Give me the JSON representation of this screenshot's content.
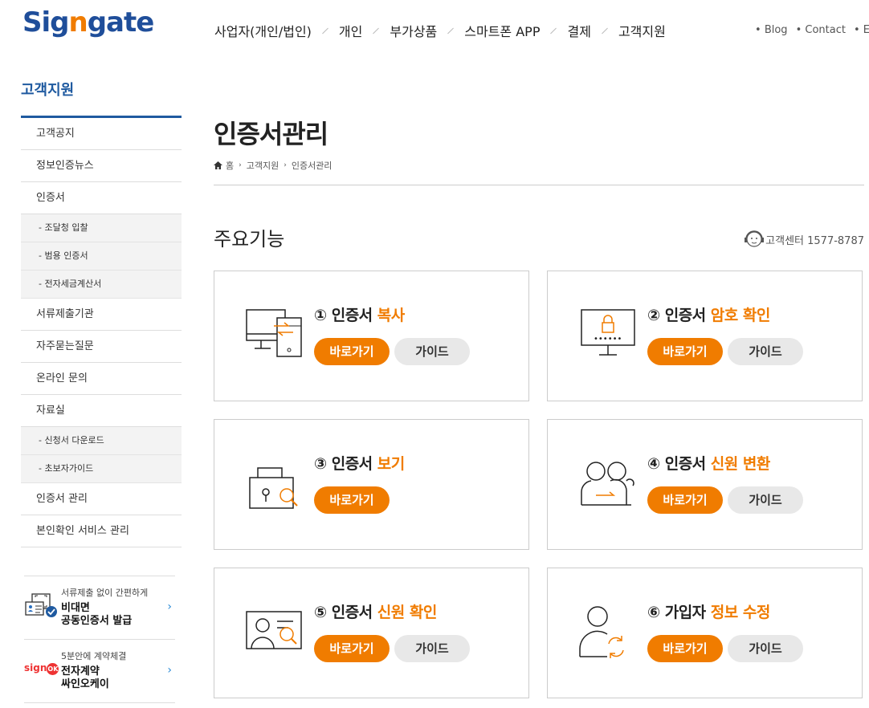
{
  "header": {
    "logo": "Signgate",
    "nav": [
      "사업자(개인/법인)",
      "개인",
      "부가상품",
      "스마트폰 APP",
      "결제",
      "고객지원"
    ],
    "util": [
      "Blog",
      "Contact",
      "Eng"
    ]
  },
  "sidebar": {
    "title": "고객지원",
    "items": [
      {
        "label": "고객공지",
        "sub": false
      },
      {
        "label": "정보인증뉴스",
        "sub": false
      },
      {
        "label": "인증서",
        "sub": false
      },
      {
        "label": "- 조달청 입찰",
        "sub": true
      },
      {
        "label": "- 범용 인증서",
        "sub": true
      },
      {
        "label": "- 전자세금계산서",
        "sub": true
      },
      {
        "label": "서류제출기관",
        "sub": false
      },
      {
        "label": "자주묻는질문",
        "sub": false
      },
      {
        "label": "온라인 문의",
        "sub": false
      },
      {
        "label": "자료실",
        "sub": false
      },
      {
        "label": "- 신청서 다운로드",
        "sub": true
      },
      {
        "label": "- 초보자가이드",
        "sub": true
      },
      {
        "label": "인증서 관리",
        "sub": false
      },
      {
        "label": "본인확인 서비스 관리",
        "sub": false
      }
    ],
    "banners": [
      {
        "small": "서류제출 없이 간편하게",
        "big": "비대면\n공동인증서 발급"
      },
      {
        "small": "5분안에 계약체결",
        "big": "전자계약\n싸인오케이",
        "logo": "sign",
        "badge": "OK"
      }
    ]
  },
  "main": {
    "title": "인증서관리",
    "breadcrumb": [
      "홈",
      "고객지원",
      "인증서관리"
    ],
    "section": "주요기능",
    "support": "고객센터 1577-8787",
    "go_label": "바로가기",
    "guide_label": "가이드",
    "cards": [
      {
        "num": "①",
        "pre": "인증서 ",
        "hl": "복사",
        "guide": true,
        "icon": "copy-icon"
      },
      {
        "num": "②",
        "pre": "인증서 ",
        "hl": "암호 확인",
        "guide": true,
        "icon": "password-monitor-icon"
      },
      {
        "num": "③",
        "pre": "인증서 ",
        "hl": "보기",
        "guide": false,
        "icon": "lock-search-icon"
      },
      {
        "num": "④",
        "pre": "인증서 ",
        "hl": "신원 변환",
        "guide": true,
        "icon": "identity-transfer-icon"
      },
      {
        "num": "⑤",
        "pre": "인증서 ",
        "hl": "신원 확인",
        "guide": true,
        "icon": "id-card-search-icon"
      },
      {
        "num": "⑥",
        "pre": "가입자 ",
        "hl": "정보 수정",
        "guide": true,
        "icon": "user-refresh-icon"
      }
    ]
  },
  "colors": {
    "brand": "#1f5aa0",
    "accent": "#f07c00"
  }
}
